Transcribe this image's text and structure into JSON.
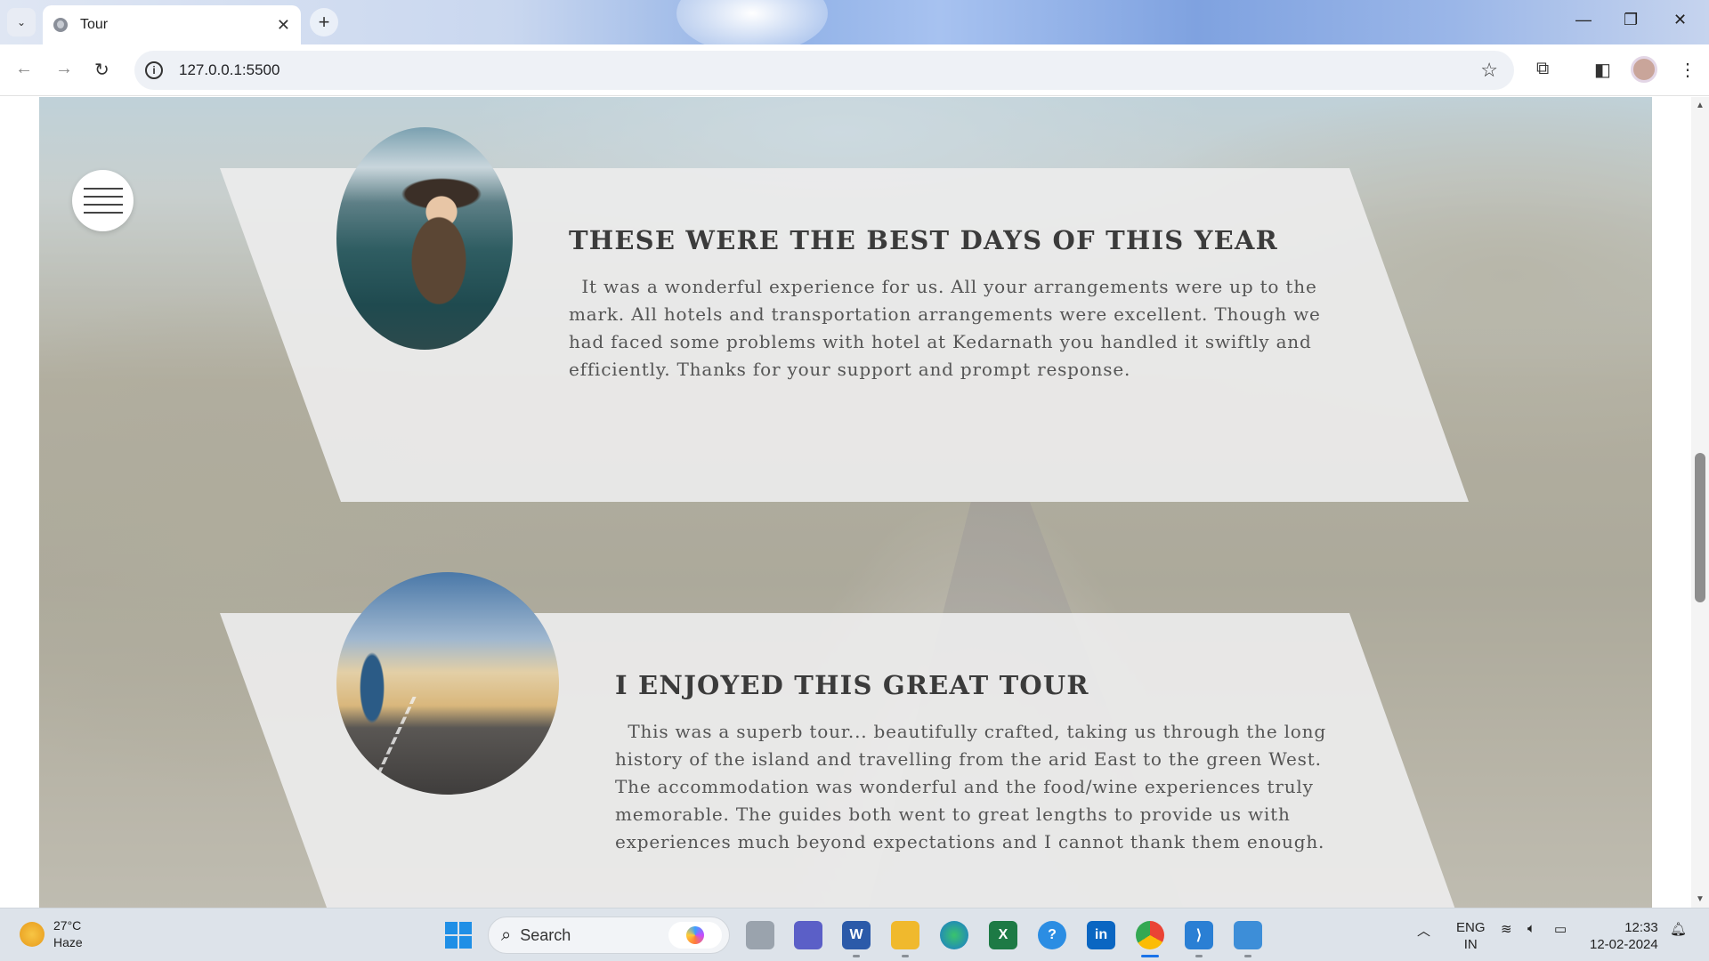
{
  "browser": {
    "tab_title": "Tour",
    "url": "127.0.0.1:5500"
  },
  "page": {
    "testimonials": [
      {
        "title": "THESE WERE THE BEST DAYS OF THIS YEAR",
        "text": "  It was a wonderful experience for us. All your arrangements were up to the mark. All hotels and transportation arrangements were excellent. Though we had faced some problems with hotel at Kedarnath you handled it swiftly and efficiently. Thanks for your support and prompt response."
      },
      {
        "title": "I ENJOYED THIS GREAT TOUR",
        "text": "  This was a superb tour... beautifully crafted, taking us through the long history of the island and travelling from the arid East to the green West. The accommodation was wonderful and the food/wine experiences truly memorable. The guides both went to great lengths to provide us with experiences much beyond expectations and I cannot thank them enough."
      }
    ]
  },
  "taskbar": {
    "weather_temp": "27°C",
    "weather_cond": "Haze",
    "search_label": "Search",
    "lang_line1": "ENG",
    "lang_line2": "IN",
    "time": "12:33",
    "date": "12-02-2024"
  },
  "icons": [
    "tab-dropdown-icon",
    "close-icon",
    "plus-icon",
    "back-icon",
    "forward-icon",
    "reload-icon",
    "info-icon",
    "star-icon",
    "extensions-icon",
    "sidepanel-icon",
    "menu-dots-icon",
    "hamburger-icon",
    "windows-start-icon",
    "search-icon"
  ]
}
